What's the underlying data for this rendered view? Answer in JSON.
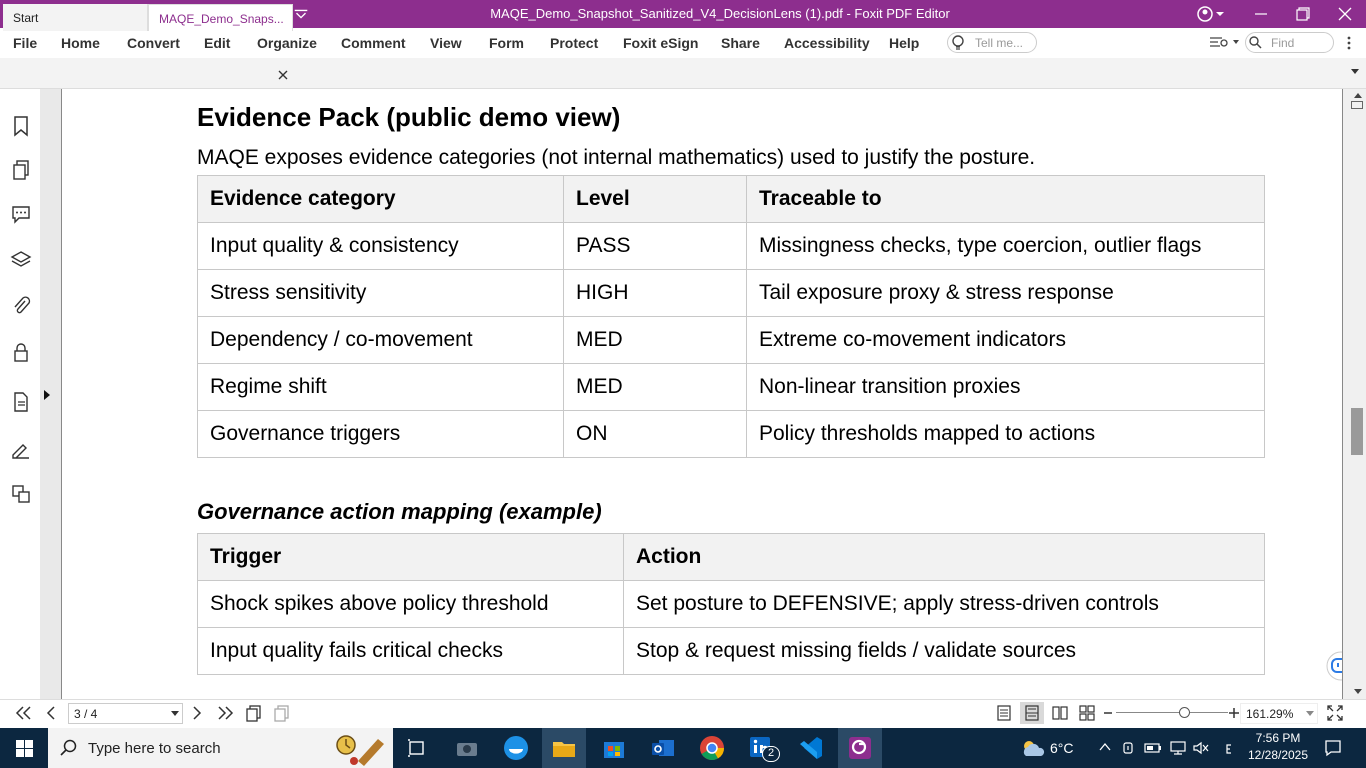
{
  "window": {
    "title": "MAQE_Demo_Snapshot_Sanitized_V4_DecisionLens (1).pdf - Foxit PDF Editor"
  },
  "menu": {
    "items": [
      "File",
      "Home",
      "Convert",
      "Edit",
      "Organize",
      "Comment",
      "View",
      "Form",
      "Protect",
      "Foxit eSign",
      "Share",
      "Accessibility",
      "Help"
    ],
    "tell_me_placeholder": "Tell me...",
    "find_placeholder": "Find"
  },
  "tabs": {
    "start": "Start",
    "doc": "MAQE_Demo_Snaps..."
  },
  "document": {
    "heading": "Evidence Pack (public demo view)",
    "intro": "MAQE exposes evidence categories (not internal mathematics) used to justify the posture.",
    "evidence_table": {
      "headers": [
        "Evidence category",
        "Level",
        "Traceable to"
      ],
      "rows": [
        [
          "Input quality & consistency",
          "PASS",
          "Missingness checks, type coercion, outlier flags"
        ],
        [
          "Stress sensitivity",
          "HIGH",
          "Tail exposure proxy & stress response"
        ],
        [
          "Dependency / co-movement",
          "MED",
          "Extreme co-movement indicators"
        ],
        [
          "Regime shift",
          "MED",
          "Non-linear transition proxies"
        ],
        [
          "Governance triggers",
          "ON",
          "Policy thresholds mapped to actions"
        ]
      ]
    },
    "subheading": "Governance action mapping (example)",
    "action_table": {
      "headers": [
        "Trigger",
        "Action"
      ],
      "rows": [
        [
          "Shock spikes above policy threshold",
          "Set posture to DEFENSIVE; apply stress-driven controls"
        ],
        [
          "Input quality fails critical checks",
          "Stop & request missing fields / validate sources"
        ]
      ]
    }
  },
  "statusbar": {
    "page": "3 / 4",
    "zoom": "161.29%",
    "zoom_level": 0.62
  },
  "taskbar": {
    "search_placeholder": "Type here to search",
    "weather": "6°C",
    "time": "7:56 PM",
    "date": "12/28/2025",
    "badge": "2"
  },
  "colors": {
    "brand": "#8d2e8e",
    "taskbar": "#0c2740"
  }
}
